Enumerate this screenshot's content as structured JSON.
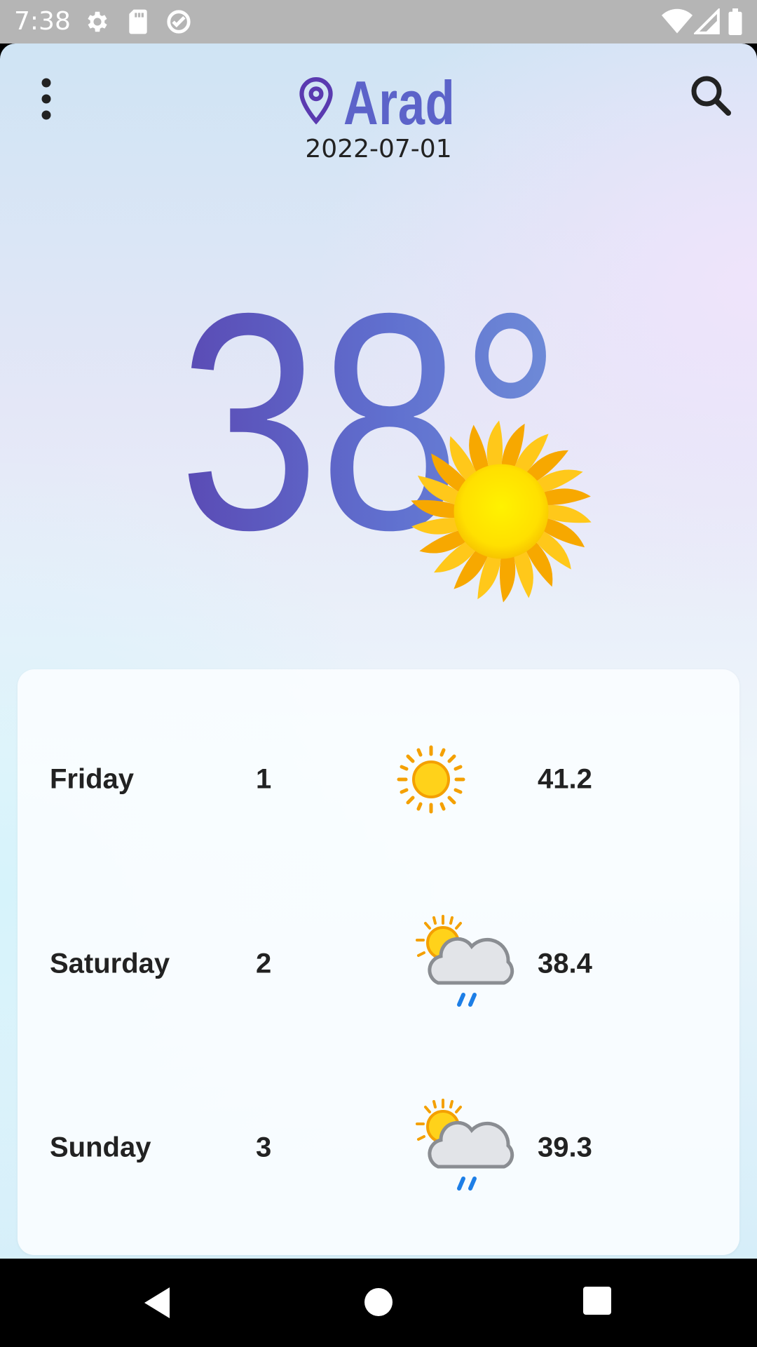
{
  "status_bar": {
    "time": "7:38",
    "left_icons": [
      "settings-icon",
      "sd-card-icon",
      "data-saver-icon"
    ],
    "right_icons": [
      "wifi-icon",
      "signal-icon",
      "battery-icon"
    ]
  },
  "header": {
    "city": "Arad",
    "date": "2022-07-01",
    "menu_icon": "more-vert-icon",
    "search_icon": "search-icon",
    "location_icon": "location-pin-icon"
  },
  "current": {
    "temperature": "38°",
    "condition_icon": "sun-icon"
  },
  "forecast": [
    {
      "day": "Friday",
      "index": "1",
      "icon": "sunny-icon",
      "temp": "41.2"
    },
    {
      "day": "Saturday",
      "index": "2",
      "icon": "sun-cloud-rain-icon",
      "temp": "38.4"
    },
    {
      "day": "Sunday",
      "index": "3",
      "icon": "sun-cloud-rain-icon",
      "temp": "39.3"
    }
  ],
  "nav_bar": {
    "back": "back-icon",
    "home": "home-icon",
    "recents": "recents-icon"
  },
  "colors": {
    "accent": "#5c63c9",
    "status_bar": "#b5b5b5",
    "text": "#222222"
  }
}
